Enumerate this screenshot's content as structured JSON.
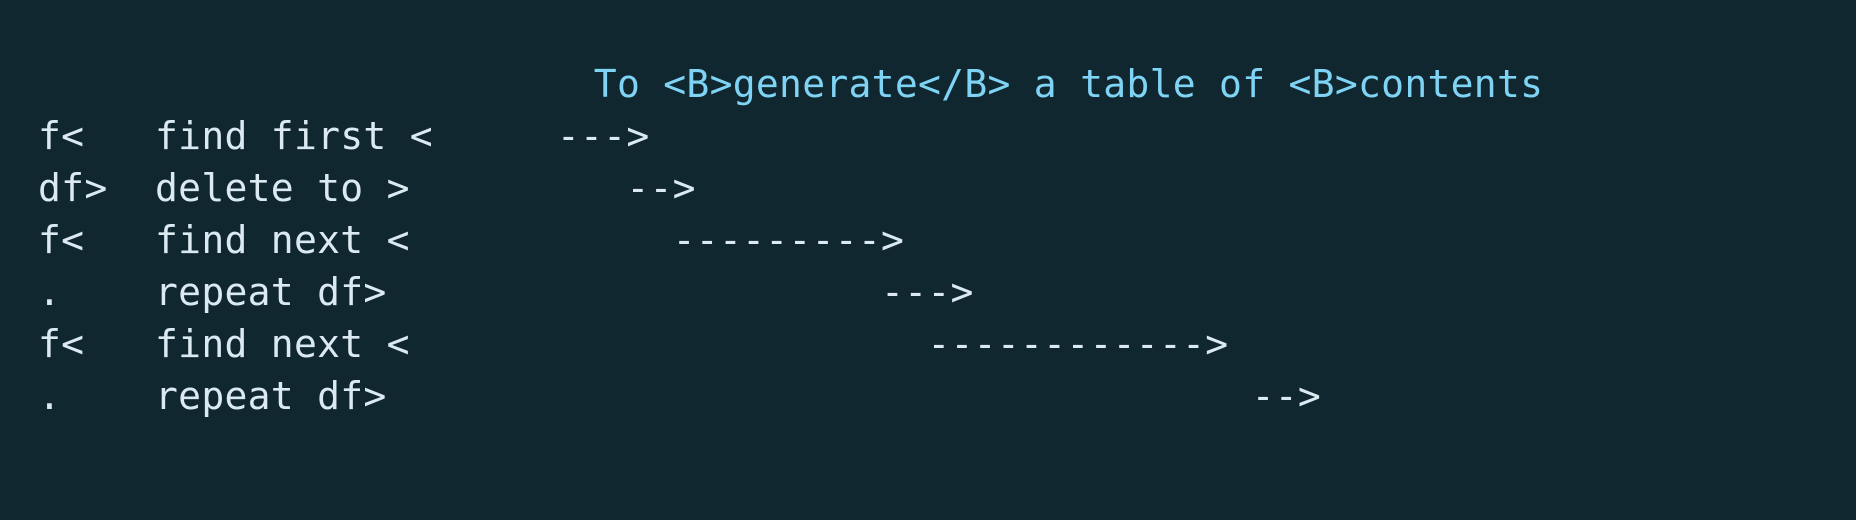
{
  "terminal": {
    "background_color": "#10272f",
    "text_color": "#dbeaf0",
    "highlight_color": "#7fd4f5",
    "header_line": "                        To <B>generate</B> a table of <B>contents",
    "rows": [
      {
        "key": "f<",
        "description": "find first <",
        "arrow": "                  --->"
      },
      {
        "key": "df>",
        "description": "delete to >",
        "arrow": "                     -->"
      },
      {
        "key": "f<",
        "description": "find next <",
        "arrow": "                       --------->"
      },
      {
        "key": ".",
        "description": "repeat df>",
        "arrow": "                                --->"
      },
      {
        "key": "f<",
        "description": "find next <",
        "arrow": "                                  ------------>"
      },
      {
        "key": ".",
        "description": "repeat df>",
        "arrow": "                                                -->"
      }
    ]
  }
}
